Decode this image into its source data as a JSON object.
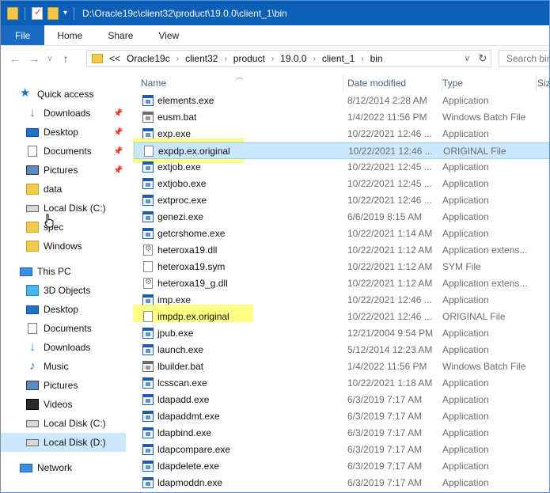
{
  "titlebar": {
    "path": "D:\\Oracle19c\\client32\\product\\19.0.0\\client_1\\bin",
    "accent": "#0b5fb8"
  },
  "ribbon": {
    "tabs": [
      "File",
      "Home",
      "Share",
      "View"
    ]
  },
  "navbar": {
    "back": "←",
    "forward": "→",
    "recent": "∨",
    "up": "↑",
    "crumbs": [
      "<<",
      "Oracle19c",
      "client32",
      "product",
      "19.0.0",
      "client_1",
      "bin"
    ],
    "refresh": "↻",
    "search_placeholder": "Search bin"
  },
  "sidebar": {
    "items": [
      {
        "label": "Quick access",
        "icon": "star-icon",
        "pinned": false
      },
      {
        "label": "Downloads",
        "icon": "download-icon",
        "pinned": true
      },
      {
        "label": "Desktop",
        "icon": "desktop-icon",
        "pinned": true
      },
      {
        "label": "Documents",
        "icon": "documents-icon",
        "pinned": true
      },
      {
        "label": "Pictures",
        "icon": "pictures-icon",
        "pinned": true
      },
      {
        "label": "data",
        "icon": "folder-icon",
        "pinned": false
      },
      {
        "label": "Local Disk (C:)",
        "icon": "drive-icon",
        "pinned": false
      },
      {
        "label": "spec",
        "icon": "folder-icon",
        "pinned": false
      },
      {
        "label": "Windows",
        "icon": "folder-icon",
        "pinned": false
      },
      {
        "label": "This PC",
        "icon": "computer-icon",
        "pinned": false
      },
      {
        "label": "3D Objects",
        "icon": "3d-objects-icon",
        "pinned": false
      },
      {
        "label": "Desktop",
        "icon": "desktop-icon",
        "pinned": false
      },
      {
        "label": "Documents",
        "icon": "documents-icon",
        "pinned": false
      },
      {
        "label": "Downloads",
        "icon": "download-icon",
        "pinned": false
      },
      {
        "label": "Music",
        "icon": "music-icon",
        "pinned": false
      },
      {
        "label": "Pictures",
        "icon": "pictures-icon",
        "pinned": false
      },
      {
        "label": "Videos",
        "icon": "videos-icon",
        "pinned": false
      },
      {
        "label": "Local Disk (C:)",
        "icon": "drive-icon",
        "pinned": false
      },
      {
        "label": "Local Disk (D:)",
        "icon": "drive-icon",
        "pinned": false,
        "selected": true
      },
      {
        "label": "Network",
        "icon": "network-icon",
        "pinned": false
      }
    ]
  },
  "columns": {
    "name": "Name",
    "date": "Date modified",
    "type": "Type",
    "size": "Size"
  },
  "files": [
    {
      "name": "elements.exe",
      "date": "8/12/2014 2:28 AM",
      "type": "Application",
      "icon": "app-icon"
    },
    {
      "name": "eusm.bat",
      "date": "1/4/2022 11:56 PM",
      "type": "Windows Batch File",
      "icon": "batch-icon"
    },
    {
      "name": "exp.exe",
      "date": "10/22/2021 12:46 ...",
      "type": "Application",
      "icon": "app-icon"
    },
    {
      "name": "expdp.ex.original",
      "date": "10/22/2021 12:46 ...",
      "type": "ORIGINAL File",
      "icon": "file-icon",
      "selected": true,
      "highlighted": true
    },
    {
      "name": "extjob.exe",
      "date": "10/22/2021 12:45 ...",
      "type": "Application",
      "icon": "app-icon"
    },
    {
      "name": "extjobo.exe",
      "date": "10/22/2021 12:45 ...",
      "type": "Application",
      "icon": "app-icon"
    },
    {
      "name": "extproc.exe",
      "date": "10/22/2021 12:46 ...",
      "type": "Application",
      "icon": "app-icon"
    },
    {
      "name": "genezi.exe",
      "date": "6/6/2019 8:15 AM",
      "type": "Application",
      "icon": "app-icon"
    },
    {
      "name": "getcrshome.exe",
      "date": "10/22/2021 1:14 AM",
      "type": "Application",
      "icon": "app-icon"
    },
    {
      "name": "heteroxa19.dll",
      "date": "10/22/2021 1:12 AM",
      "type": "Application extens...",
      "icon": "dll-icon"
    },
    {
      "name": "heteroxa19.sym",
      "date": "10/22/2021 1:12 AM",
      "type": "SYM File",
      "icon": "file-icon"
    },
    {
      "name": "heteroxa19_g.dll",
      "date": "10/22/2021 1:12 AM",
      "type": "Application extens...",
      "icon": "dll-icon"
    },
    {
      "name": "imp.exe",
      "date": "10/22/2021 12:46 ...",
      "type": "Application",
      "icon": "app-icon"
    },
    {
      "name": "impdp.ex.original",
      "date": "10/22/2021 12:46 ...",
      "type": "ORIGINAL File",
      "icon": "file-icon",
      "highlighted": true
    },
    {
      "name": "jpub.exe",
      "date": "12/21/2004 9:54 PM",
      "type": "Application",
      "icon": "app-icon"
    },
    {
      "name": "launch.exe",
      "date": "5/12/2014 12:23 AM",
      "type": "Application",
      "icon": "app-icon"
    },
    {
      "name": "lbuilder.bat",
      "date": "1/4/2022 11:56 PM",
      "type": "Windows Batch File",
      "icon": "batch-icon"
    },
    {
      "name": "lcsscan.exe",
      "date": "10/22/2021 1:18 AM",
      "type": "Application",
      "icon": "app-icon"
    },
    {
      "name": "ldapadd.exe",
      "date": "6/3/2019 7:17 AM",
      "type": "Application",
      "icon": "app-icon"
    },
    {
      "name": "ldapaddmt.exe",
      "date": "6/3/2019 7:17 AM",
      "type": "Application",
      "icon": "app-icon"
    },
    {
      "name": "ldapbind.exe",
      "date": "6/3/2019 7:17 AM",
      "type": "Application",
      "icon": "app-icon"
    },
    {
      "name": "ldapcompare.exe",
      "date": "6/3/2019 7:17 AM",
      "type": "Application",
      "icon": "app-icon"
    },
    {
      "name": "ldapdelete.exe",
      "date": "6/3/2019 7:17 AM",
      "type": "Application",
      "icon": "app-icon"
    },
    {
      "name": "ldapmoddn.exe",
      "date": "6/3/2019 7:17 AM",
      "type": "Application",
      "icon": "app-icon"
    }
  ],
  "colors": {
    "selection": "#cce8ff",
    "highlight": "#ffff6b",
    "file_tab": "#1a6bc6"
  }
}
